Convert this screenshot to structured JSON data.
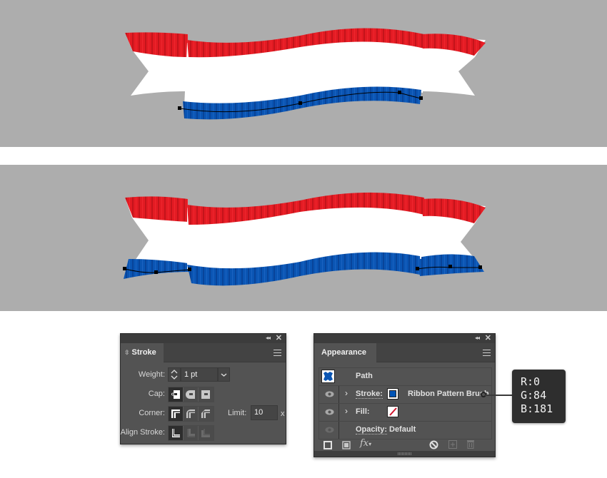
{
  "artboards": [
    {
      "name": "ribbon-top-preview",
      "selected_edge": "bottom",
      "stroke_color": "#0054B5"
    },
    {
      "name": "ribbon-bottom-preview",
      "selected_edge": "bottom",
      "stroke_color": "#0054B5"
    }
  ],
  "colors": {
    "canvas_bg": "#adadad",
    "ribbon_red": "#e31b23",
    "ribbon_white": "#ffffff",
    "ribbon_blue": "#0054b5"
  },
  "stroke_panel": {
    "tab_label": "Stroke",
    "weight_label": "Weight:",
    "weight_value": "1 pt",
    "cap_label": "Cap:",
    "cap_options": [
      "butt-cap",
      "round-cap",
      "projecting-cap"
    ],
    "cap_selected": 0,
    "corner_label": "Corner:",
    "corner_options": [
      "miter-join",
      "round-join",
      "bevel-join"
    ],
    "corner_selected": 0,
    "limit_label": "Limit:",
    "limit_value": "10",
    "limit_unit": "x",
    "align_label": "Align Stroke:",
    "align_options": [
      "align-center",
      "align-inside",
      "align-outside"
    ],
    "align_selected": 0
  },
  "appearance_panel": {
    "tab_label": "Appearance",
    "header_label": "Path",
    "rows": [
      {
        "label": "Stroke:",
        "value": "Ribbon Pattern Brush",
        "swatch": "#0054B5"
      },
      {
        "label": "Fill:",
        "value": "",
        "swatch": "none"
      },
      {
        "label": "Opacity:",
        "value": "Default"
      }
    ]
  },
  "tooltip": {
    "r": "R:0",
    "g": "G:84",
    "b": "B:181"
  }
}
